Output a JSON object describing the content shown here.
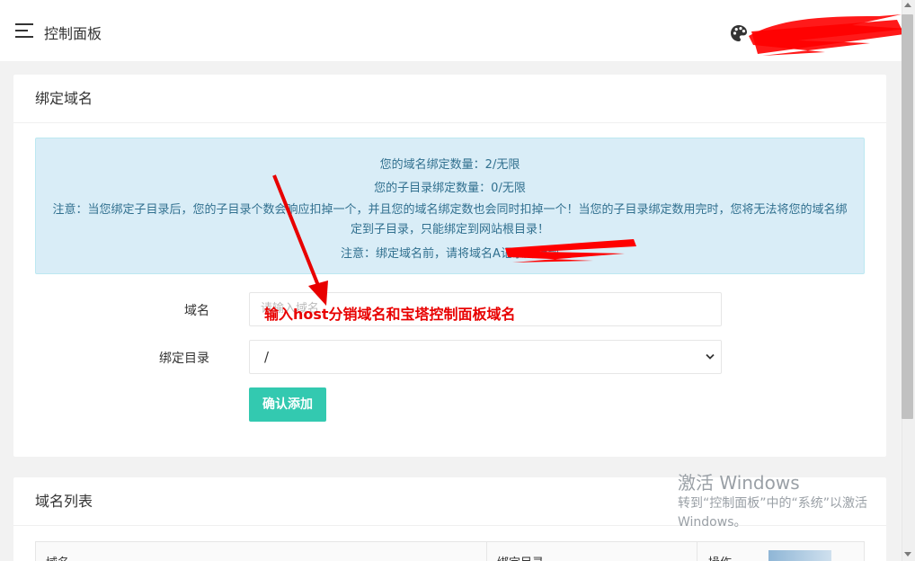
{
  "header": {
    "title": "控制面板",
    "menu_icon": "hamburger-menu-icon",
    "theme_icon": "palette-icon",
    "redaction_color": "#ff0000"
  },
  "bind_card": {
    "title": "绑定域名",
    "notice": {
      "line1": "您的域名绑定数量：2/无限",
      "line2": "您的子目录绑定数量：0/无限",
      "line3": "注意：当您绑定子目录后，您的子目录个数会响应扣掉一个，并且您的域名绑定数也会同时扣掉一个！当您的子目录绑定数用完时，您将无法将您的域名绑定到子目录，只能绑定到网站根目录！",
      "line4": "注意：绑定域名前，请将域名A记录解析到"
    },
    "form": {
      "domain_label": "域名",
      "domain_placeholder": "请输入域名",
      "dir_label": "绑定目录",
      "dir_value": "/",
      "submit_label": "确认添加"
    },
    "annotation": "输入host分销域名和宝塔控制面板域名",
    "accent_color": "#33c9b0",
    "notice_bg": "#d9edf7"
  },
  "list_card": {
    "title": "域名列表",
    "columns": [
      "域名",
      "绑定目录",
      "操作"
    ]
  },
  "watermark": {
    "title": "激活 Windows",
    "subtitle": "转到“控制面板”中的“系统”以激活 Windows。"
  }
}
